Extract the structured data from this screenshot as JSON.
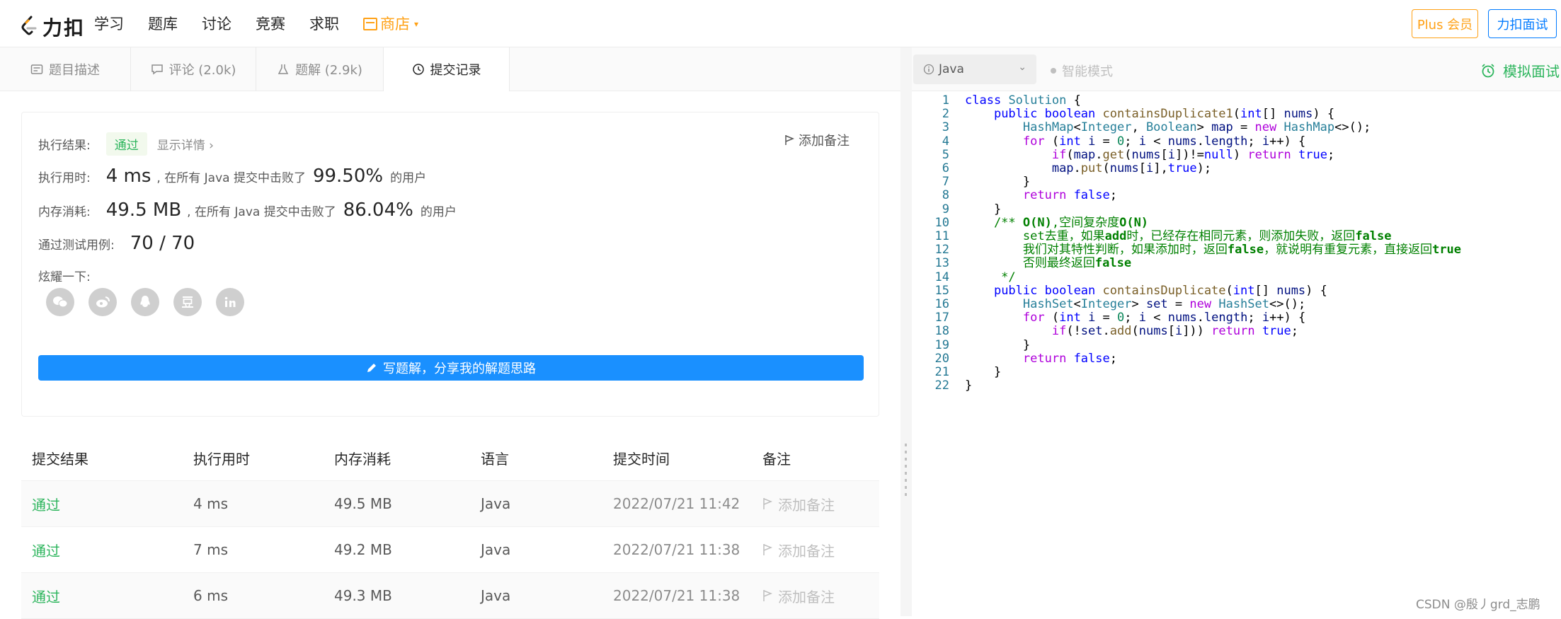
{
  "brand": {
    "name": "力扣"
  },
  "nav": {
    "items": [
      "学习",
      "题库",
      "讨论",
      "竞赛",
      "求职"
    ],
    "shop": "商店",
    "plus": "Plus 会员",
    "interview": "力扣面试"
  },
  "left_tabs": [
    {
      "label": "题目描述"
    },
    {
      "label": "评论 (2.0k)"
    },
    {
      "label": "题解 (2.9k)"
    },
    {
      "label": "提交记录"
    }
  ],
  "result": {
    "status_label": "执行结果:",
    "status": "通过",
    "detail_link": "显示详情 ›",
    "add_note": "添加备注",
    "time_label": "执行用时:",
    "time_value": "4 ms",
    "time_desc": ", 在所有 Java 提交中击败了",
    "time_pct": "99.50%",
    "users": "的用户",
    "mem_label": "内存消耗:",
    "mem_value": "49.5 MB",
    "mem_desc": ", 在所有 Java 提交中击败了",
    "mem_pct": "86.04%",
    "tests_label": "通过测试用例:",
    "tests_value": "70  /  70",
    "share_label": "炫耀一下:",
    "share_icons": [
      "wechat-icon",
      "weibo-icon",
      "qq-icon",
      "douban-icon",
      "linkedin-icon"
    ],
    "write_button": "写题解，分享我的解题思路"
  },
  "submissions": {
    "headers": [
      "提交结果",
      "执行用时",
      "内存消耗",
      "语言",
      "提交时间",
      "备注"
    ],
    "rows": [
      {
        "result": "通过",
        "time": "4 ms",
        "memory": "49.5 MB",
        "lang": "Java",
        "submitted": "2022/07/21 11:42",
        "note": "添加备注"
      },
      {
        "result": "通过",
        "time": "7 ms",
        "memory": "49.2 MB",
        "lang": "Java",
        "submitted": "2022/07/21 11:38",
        "note": "添加备注"
      },
      {
        "result": "通过",
        "time": "6 ms",
        "memory": "49.3 MB",
        "lang": "Java",
        "submitted": "2022/07/21 11:38",
        "note": "添加备注"
      }
    ]
  },
  "editor": {
    "language": "Java",
    "smart_mode": "智能模式",
    "mock_interview": "模拟面试",
    "line_numbers": [
      "1",
      "2",
      "3",
      "4",
      "5",
      "6",
      "7",
      "8",
      "9",
      "10",
      "11",
      "12",
      "13",
      "14",
      "15",
      "16",
      "17",
      "18",
      "19",
      "20",
      "21",
      "22"
    ],
    "code_lines": [
      "class Solution {",
      "    public boolean containsDuplicate1(int[] nums) {",
      "        HashMap<Integer, Boolean> map = new HashMap<>();",
      "        for (int i = 0; i < nums.length; i++) {",
      "            if(map.get(nums[i])!=null) return true;",
      "            map.put(nums[i],true);",
      "        }",
      "        return false;",
      "    }",
      "    /** O(N),空间复杂度O(N)",
      "        set去重，如果add时，已经存在相同元素，则添加失败，返回false",
      "        我们对其特性判断，如果添加时，返回false，就说明有重复元素，直接返回true",
      "        否则最终返回false",
      "     */",
      "    public boolean containsDuplicate(int[] nums) {",
      "        HashSet<Integer> set = new HashSet<>();",
      "        for (int i = 0; i < nums.length; i++) {",
      "            if(!set.add(nums[i])) return true;",
      "        }",
      "        return false;",
      "    }",
      "}"
    ]
  },
  "watermark": "CSDN @殷丿grd_志鹏",
  "colors": {
    "accent": "#1a90ff",
    "pass": "#2db55d",
    "orange": "#ffa116"
  }
}
